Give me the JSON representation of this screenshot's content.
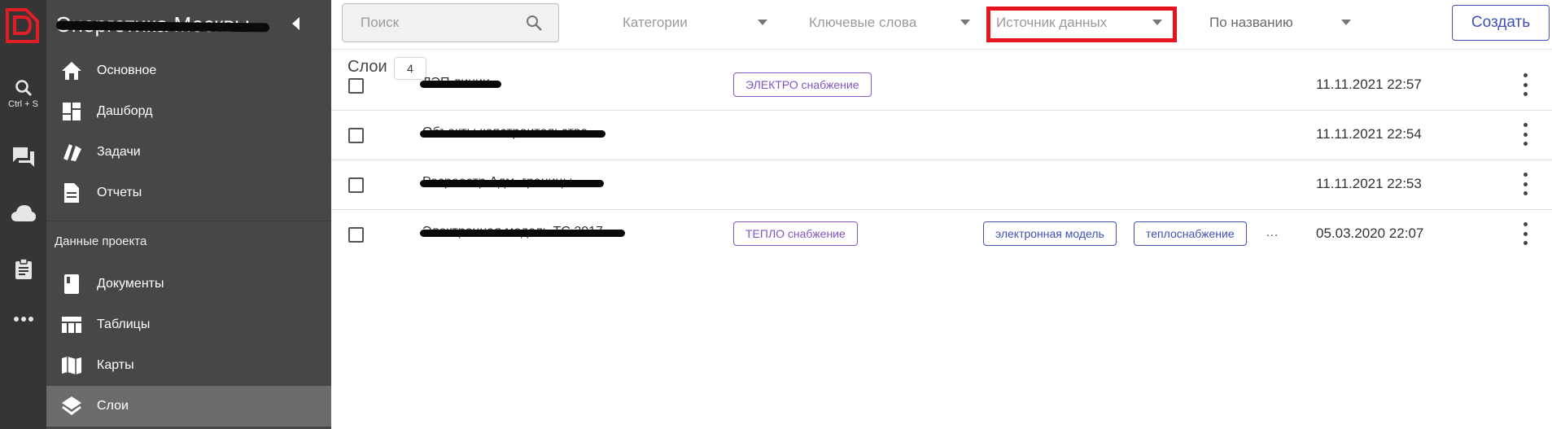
{
  "rail": {
    "logo_icon": "app-logo",
    "search_hint": "Ctrl + S",
    "buttons": [
      "search-icon",
      "chat-icon",
      "cloud-icon",
      "clipboard-icon",
      "more-icon"
    ]
  },
  "sidebar": {
    "project_title": "Энергетика Москвы",
    "items_main": [
      {
        "label": "Основное",
        "icon": "home-icon"
      },
      {
        "label": "Дашборд",
        "icon": "dashboard-icon"
      },
      {
        "label": "Задачи",
        "icon": "tasks-icon"
      },
      {
        "label": "Отчеты",
        "icon": "report-icon"
      }
    ],
    "section_label": "Данные проекта",
    "items_data": [
      {
        "label": "Документы",
        "icon": "book-icon"
      },
      {
        "label": "Таблицы",
        "icon": "table-icon"
      },
      {
        "label": "Карты",
        "icon": "map-icon"
      },
      {
        "label": "Слои",
        "icon": "layers-icon",
        "active": true
      }
    ]
  },
  "toolbar": {
    "search_placeholder": "Поиск",
    "filter_categories": "Категории",
    "filter_keywords": "Ключевые слова",
    "filter_source": "Источник данных",
    "sort_label": "По названию",
    "create_label": "Создать"
  },
  "content": {
    "title": "Слои",
    "count": "4",
    "rows": [
      {
        "name": "ЛЭП линии",
        "category": "ЭЛЕКТРО снабжение",
        "tags": [],
        "more": "",
        "date": "11.11.2021 22:57"
      },
      {
        "name": "Объекты капстроительства",
        "category": "",
        "tags": [],
        "more": "",
        "date": "11.11.2021 22:54"
      },
      {
        "name": "Росреестр Адм. границы",
        "category": "",
        "tags": [],
        "more": "",
        "date": "11.11.2021 22:53"
      },
      {
        "name": "Электронная модель ТС 2017",
        "category": "ТЕПЛО снабжение",
        "tags": [
          "электронная модель",
          "теплоснабжение"
        ],
        "more": "…",
        "date": "05.03.2020 22:07"
      }
    ]
  },
  "colors": {
    "rail": "#353535",
    "sidebar": "#474747",
    "active_item": "#6b6b6b",
    "accent_primary": "#3f51b5",
    "accent_category": "#7e57c2",
    "highlight_box": "#e6141f",
    "logo_red": "#e11d26"
  }
}
